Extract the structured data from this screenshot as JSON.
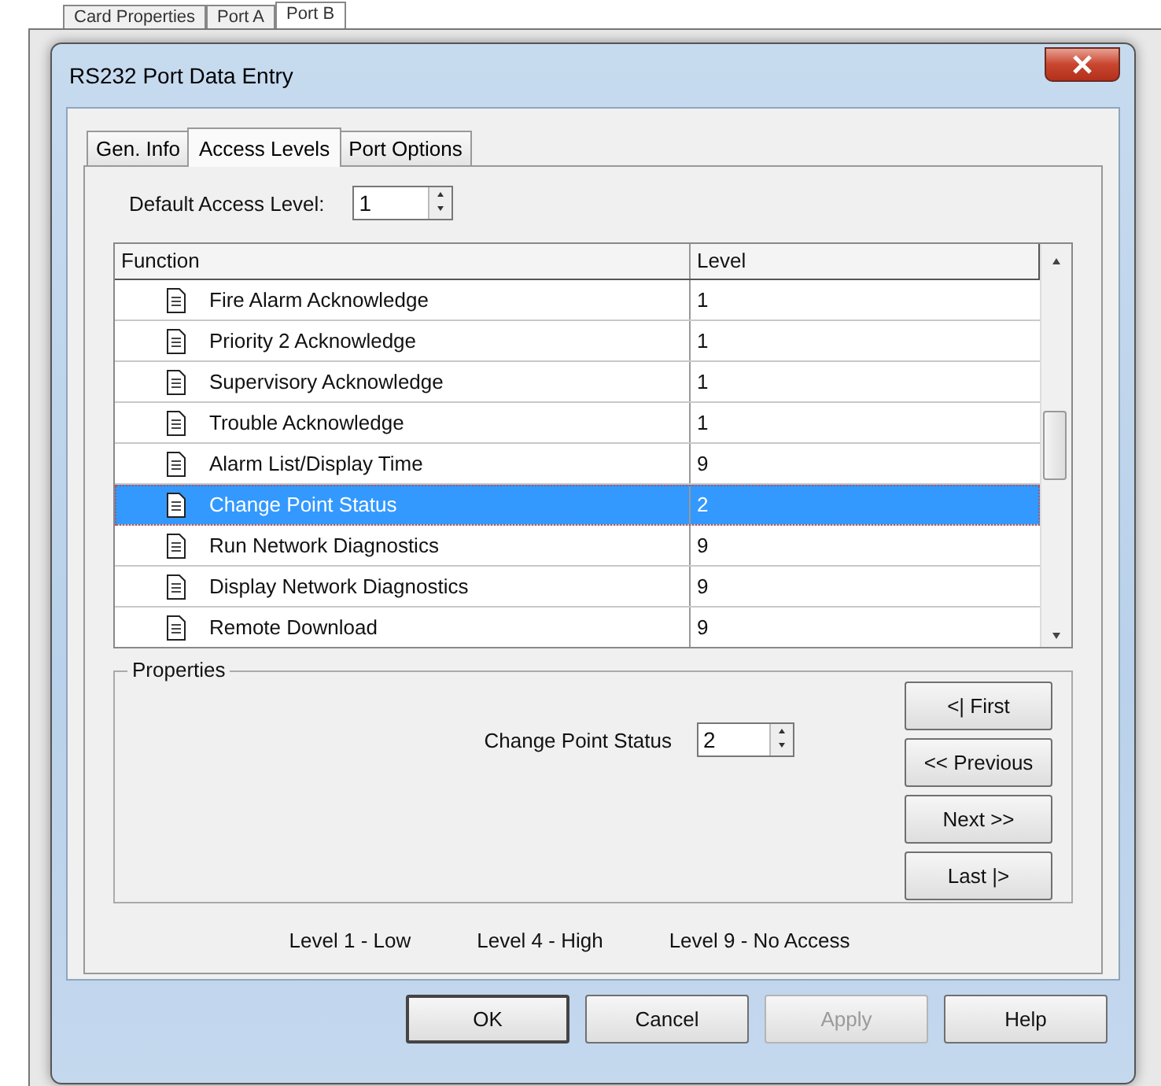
{
  "background_tabs": [
    {
      "label": "Card Properties",
      "selected": false
    },
    {
      "label": "Port A",
      "selected": false
    },
    {
      "label": "Port B",
      "selected": true
    }
  ],
  "window": {
    "title": "RS232 Port Data Entry"
  },
  "tabs": [
    {
      "label": "Gen. Info",
      "selected": false
    },
    {
      "label": "Access Levels",
      "selected": true
    },
    {
      "label": "Port Options",
      "selected": false
    }
  ],
  "default_access": {
    "label": "Default Access Level:",
    "value": "1"
  },
  "table": {
    "columns": [
      "Function",
      "Level"
    ],
    "rows": [
      {
        "function": "Fire Alarm Acknowledge",
        "level": "1",
        "selected": false
      },
      {
        "function": "Priority 2 Acknowledge",
        "level": "1",
        "selected": false
      },
      {
        "function": "Supervisory Acknowledge",
        "level": "1",
        "selected": false
      },
      {
        "function": "Trouble Acknowledge",
        "level": "1",
        "selected": false
      },
      {
        "function": "Alarm List/Display Time",
        "level": "9",
        "selected": false
      },
      {
        "function": "Change Point Status",
        "level": "2",
        "selected": true
      },
      {
        "function": "Run Network Diagnostics",
        "level": "9",
        "selected": false
      },
      {
        "function": "Display Network Diagnostics",
        "level": "9",
        "selected": false
      },
      {
        "function": "Remote Download",
        "level": "9",
        "selected": false
      }
    ]
  },
  "properties": {
    "title": "Properties",
    "field_label": "Change Point Status",
    "field_value": "2",
    "nav_buttons": [
      "<| First",
      "<< Previous",
      "Next >>",
      "Last |>"
    ]
  },
  "legend": [
    "Level 1 - Low",
    "Level 4 - High",
    "Level 9 - No Access"
  ],
  "buttons": [
    {
      "label": "OK",
      "disabled": false,
      "default": true
    },
    {
      "label": "Cancel",
      "disabled": false,
      "default": false
    },
    {
      "label": "Apply",
      "disabled": true,
      "default": false
    },
    {
      "label": "Help",
      "disabled": false,
      "default": false
    }
  ]
}
